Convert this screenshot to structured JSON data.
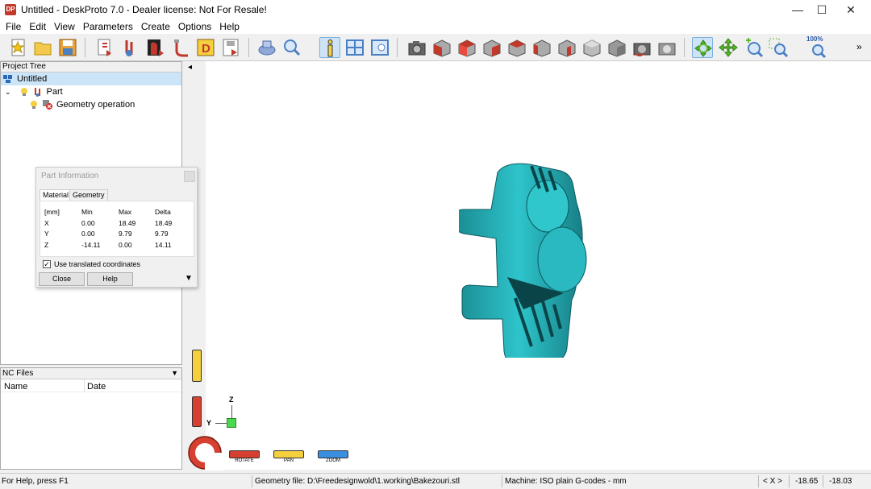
{
  "window": {
    "app_icon": "DP",
    "title": "Untitled - DeskProto 7.0 - Dealer license: Not For Resale!",
    "minimize": "—",
    "maximize": "☐",
    "close": "✕"
  },
  "menu": [
    "File",
    "Edit",
    "View",
    "Parameters",
    "Create",
    "Options",
    "Help"
  ],
  "toolbar": {
    "zoom_label": "100%",
    "more": "»"
  },
  "project_tree": {
    "header": "Project Tree",
    "root": "Untitled",
    "part": "Part",
    "operation": "Geometry operation"
  },
  "nc_files": {
    "header": "NC Files",
    "col_name": "Name",
    "col_date": "Date"
  },
  "part_info": {
    "title": "Part Information",
    "tabs": [
      "Material",
      "Geometry"
    ],
    "table": {
      "headers": [
        "[mm]",
        "Min",
        "Max",
        "Delta"
      ],
      "rows": [
        [
          "X",
          "0.00",
          "18.49",
          "18.49"
        ],
        [
          "Y",
          "0.00",
          "9.79",
          "9.79"
        ],
        [
          "Z",
          "-14.11",
          "0.00",
          "14.11"
        ]
      ]
    },
    "checkbox_label": "Use translated coordinates",
    "checkbox_checked": "✓",
    "close_btn": "Close",
    "help_btn": "Help"
  },
  "viewport": {
    "axis_z": "Z",
    "axis_y": "Y",
    "modes": [
      "ROTATE",
      "PAN",
      "ZOOM"
    ],
    "collapse_arrow": "◂",
    "dialog_arrow": "▼",
    "part_color": "#26b5bc"
  },
  "status": {
    "help": "For Help, press F1",
    "geometry_file": "Geometry file: D:\\Freedesignwold\\1.working\\Bakezouri.stl",
    "machine": "Machine: ISO plain G-codes - mm",
    "axis_sel": "< X >",
    "coord1": "-18.65",
    "coord2": "-18.03"
  }
}
